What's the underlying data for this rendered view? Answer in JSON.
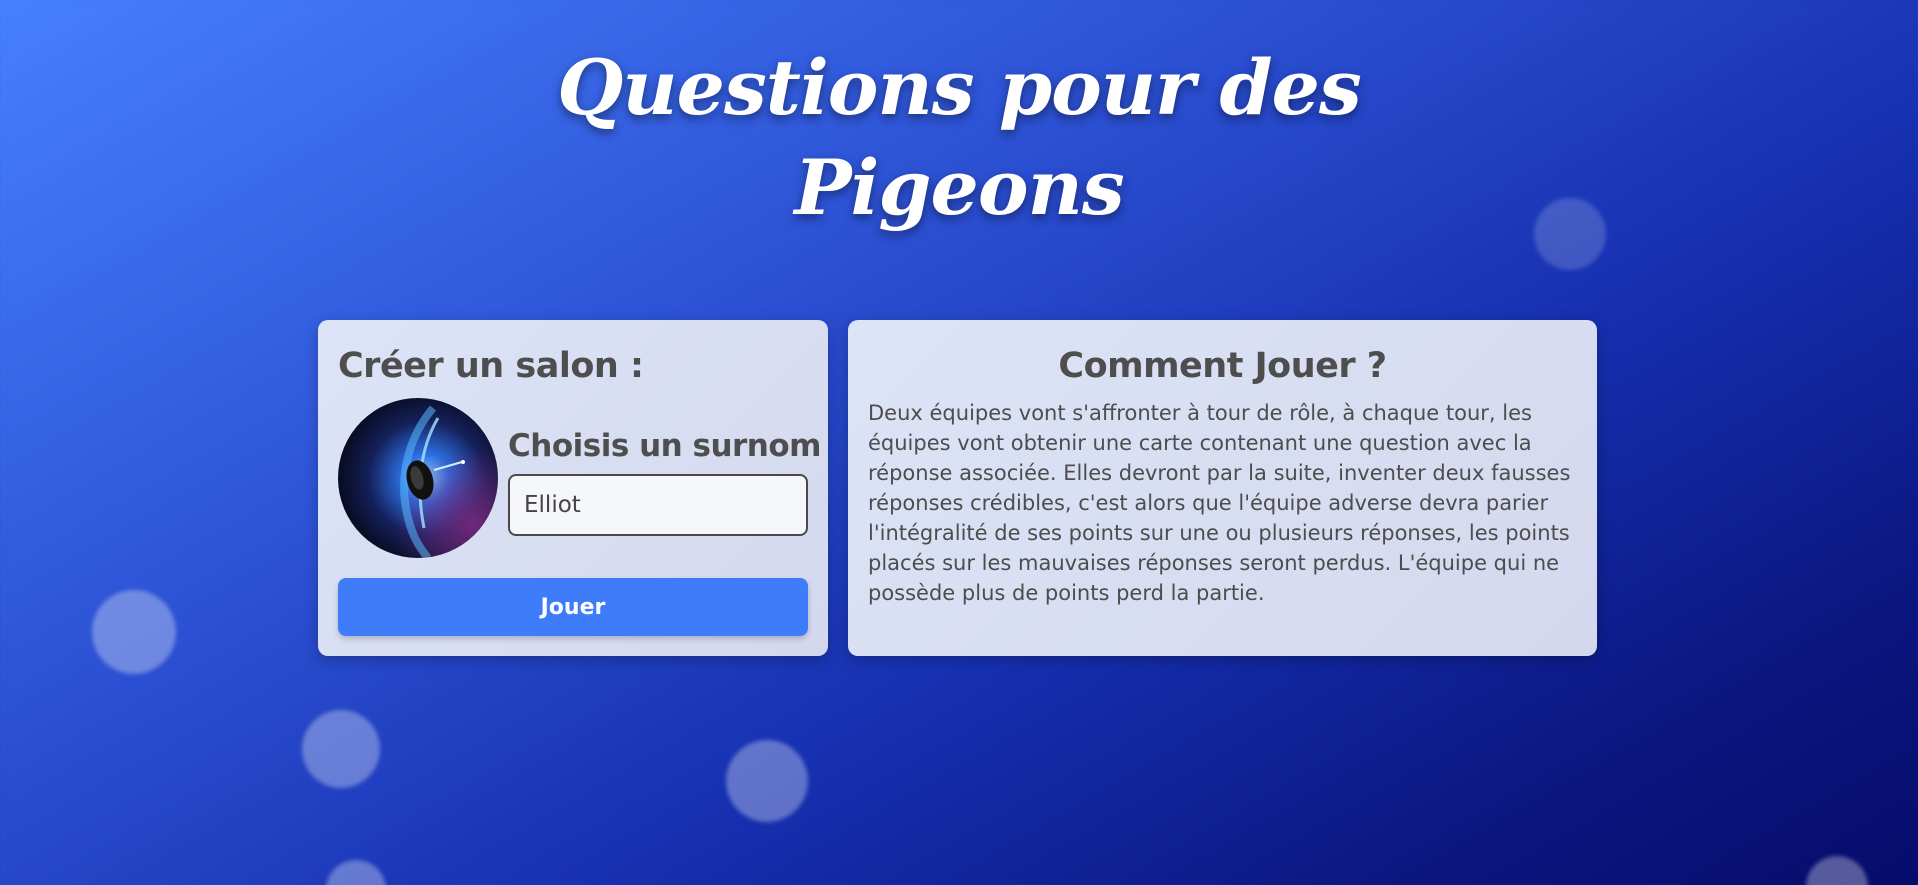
{
  "header": {
    "title_line1": "Questions pour des",
    "title_line2": "Pigeons"
  },
  "create_room": {
    "heading": "Créer un salon :",
    "avatar_icon": "galaxy-avatar-icon",
    "nickname_label": "Choisis un surnom",
    "nickname_value": "Elliot",
    "play_label": "Jouer"
  },
  "how_to_play": {
    "heading": "Comment Jouer ?",
    "text": "Deux équipes vont s'affronter à tour de rôle, à chaque tour, les équipes vont obtenir une carte contenant une question avec la réponse associée. Elles devront par la suite, inventer deux fausses réponses crédibles, c'est alors que l'équipe adverse devra parier l'intégralité de ses points sur une ou plusieurs réponses, les points placés sur les mauvaises réponses seront perdus. L'équipe qui ne possède plus de points perd la partie."
  },
  "colors": {
    "accent": "#3f7cfa",
    "background_start": "#4680ff",
    "background_end": "#060c6a",
    "card": "#dde4f7"
  }
}
